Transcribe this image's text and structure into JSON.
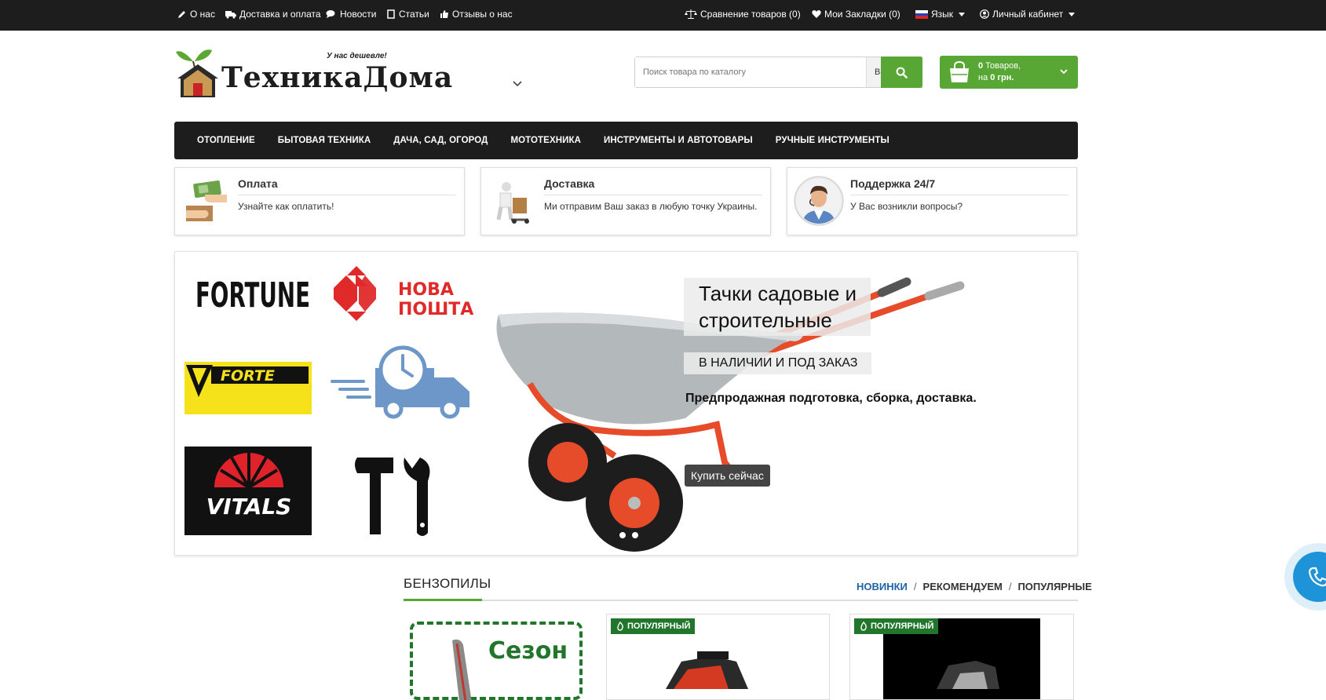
{
  "topbar": {
    "about": "О нас",
    "delivery": "Доставка и оплата",
    "news": "Новости",
    "articles": "Статьи",
    "reviews": "Отзывы о нас",
    "compare": "Сравнение товаров (0)",
    "wishlist": "Мои Закладки (0)",
    "language": "Язык",
    "account": "Личный кабинет"
  },
  "logo": {
    "name": "ТехникаДома",
    "slogan": "У нас дешевле!"
  },
  "search": {
    "placeholder": "Поиск товара по каталогу",
    "scope": "Везде"
  },
  "cart": {
    "count": "0",
    "count_suffix": " Товаров,",
    "total_prefix": "на ",
    "total": "0 грн."
  },
  "nav": [
    "ОТОПЛЕНИЕ",
    "БЫТОВАЯ ТЕХНИКА",
    "ДАЧА, САД, ОГОРОД",
    "МОТОТЕХНИКА",
    "ИНСТРУМЕНТЫ И АВТОТОВАРЫ",
    "РУЧНЫЕ ИНСТРУМЕНТЫ"
  ],
  "info": [
    {
      "title": "Оплата",
      "desc": "Узнайте как оплатить!"
    },
    {
      "title": "Доставка",
      "desc": "Ми отправим Ваш заказ в любую точку Украины."
    },
    {
      "title": "Поддержка 24/7",
      "desc": "У Вас возникли вопросы?"
    }
  ],
  "slider": {
    "brands": [
      "FORTUNE",
      "НОВА",
      "ПОШТА",
      "FORTE",
      "VITALS"
    ],
    "title_line1": "Тачки садовые и",
    "title_line2": "строительные",
    "subtitle": "В НАЛИЧИИ И ПОД ЗАКАЗ",
    "description": "Предпродажная подготовка, сборка, доставка.",
    "button": "Купить сейчас"
  },
  "category": {
    "title": "БЕНЗОПИЛЫ",
    "tabs": [
      "НОВИНКИ",
      "РЕКОМЕНДУЕМ",
      "ПОПУЛЯРНЫЕ"
    ],
    "season_text": "Сезон",
    "badge": "ПОПУЛЯРНЫЙ"
  },
  "colors": {
    "green": "#58a734",
    "dark": "#1d1d1d",
    "badge_green": "#22762b",
    "active_tab": "#1e64a5"
  }
}
